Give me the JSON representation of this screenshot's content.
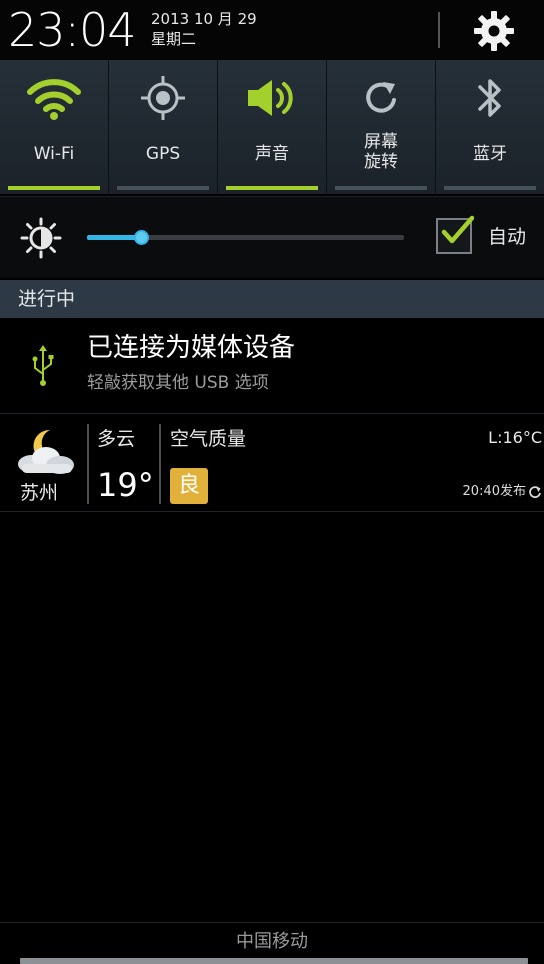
{
  "header": {
    "time": "23:04",
    "date": "2013 10 月 29",
    "weekday": "星期二",
    "settings_icon": "gear-icon"
  },
  "toggles": [
    {
      "label": "Wi-Fi",
      "icon": "wifi-icon",
      "active": true
    },
    {
      "label": "GPS",
      "icon": "gps-icon",
      "active": false
    },
    {
      "label": "声音",
      "icon": "speaker-icon",
      "active": true
    },
    {
      "label_line1": "屏幕",
      "label_line2": "旋转",
      "icon": "rotate-icon",
      "active": false
    },
    {
      "label": "蓝牙",
      "icon": "bluetooth-icon",
      "active": false
    }
  ],
  "brightness": {
    "level": 0.17,
    "auto_label": "自动",
    "auto_checked": true
  },
  "ongoing": {
    "section_title": "进行中",
    "usb": {
      "title": "已连接为媒体设备",
      "subtitle": "轻敲获取其他 USB 选项"
    }
  },
  "weather": {
    "city": "苏州",
    "condition": "多云",
    "temperature": "19°",
    "air_quality_label": "空气质量",
    "air_quality_value": "良",
    "low": "L:16°C",
    "published": "20:40发布"
  },
  "footer": {
    "carrier": "中国移动"
  },
  "colors": {
    "accent_green": "#a3d02d",
    "slider_blue": "#33b5e5",
    "aq_badge": "#e1b13a",
    "section_bg": "#2d3a46"
  }
}
